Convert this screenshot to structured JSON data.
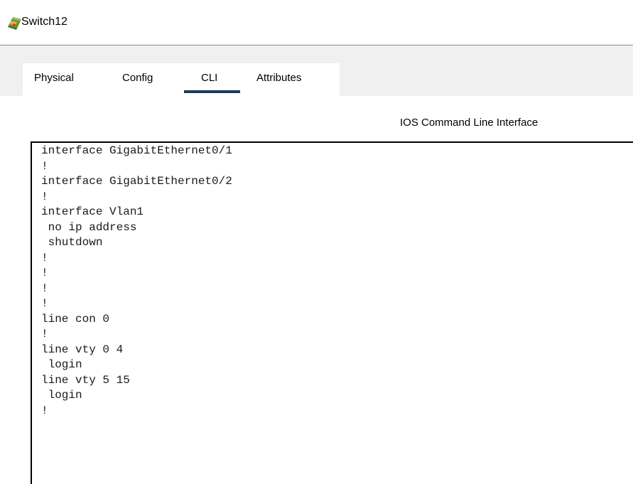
{
  "window": {
    "title": "Switch12",
    "icon": "switch-device-icon"
  },
  "tabs": [
    {
      "label": "Physical",
      "active": false
    },
    {
      "label": "Config",
      "active": false
    },
    {
      "label": "CLI",
      "active": true
    },
    {
      "label": "Attributes",
      "active": false
    }
  ],
  "cli": {
    "heading": "IOS Command Line Interface",
    "lines": [
      "interface GigabitEthernet0/1",
      "!",
      "interface GigabitEthernet0/2",
      "!",
      "interface Vlan1",
      " no ip address",
      " shutdown",
      "!",
      "!",
      "!",
      "!",
      "line con 0",
      "!",
      "line vty 0 4",
      " login",
      "line vty 5 15",
      " login",
      "!"
    ]
  },
  "colors": {
    "active_tab_underline": "#1c3a5b",
    "panel_background": "#f0f0f0",
    "terminal_border": "#000000"
  }
}
